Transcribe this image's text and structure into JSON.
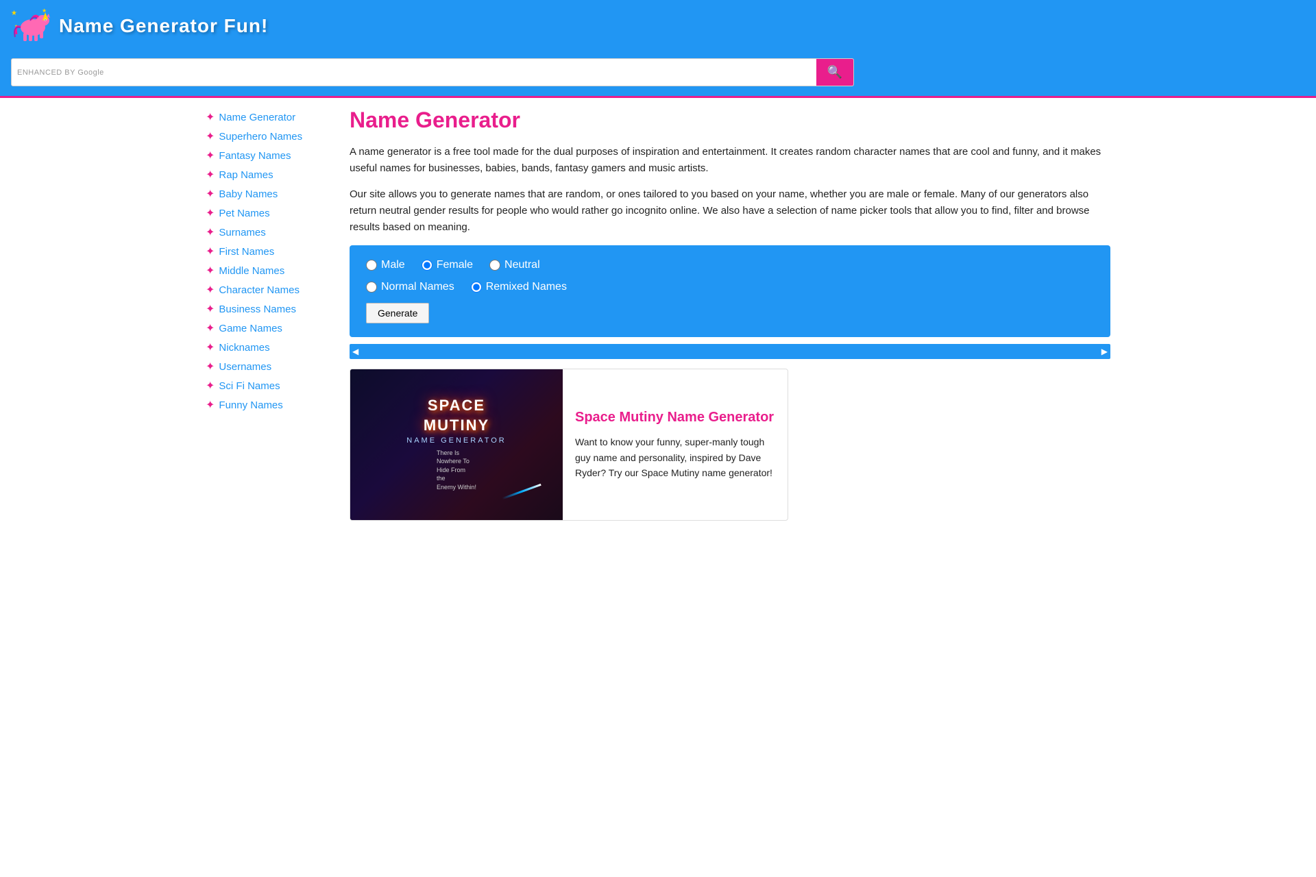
{
  "header": {
    "site_title": "Name Generator Fun!",
    "search_label": "ENHANCED BY Google",
    "search_placeholder": "",
    "search_button_icon": "🔍"
  },
  "sidebar": {
    "items": [
      {
        "label": "Name Generator",
        "id": "name-generator"
      },
      {
        "label": "Superhero Names",
        "id": "superhero-names"
      },
      {
        "label": "Fantasy Names",
        "id": "fantasy-names"
      },
      {
        "label": "Rap Names",
        "id": "rap-names"
      },
      {
        "label": "Baby Names",
        "id": "baby-names"
      },
      {
        "label": "Pet Names",
        "id": "pet-names"
      },
      {
        "label": "Surnames",
        "id": "surnames"
      },
      {
        "label": "First Names",
        "id": "first-names"
      },
      {
        "label": "Middle Names",
        "id": "middle-names"
      },
      {
        "label": "Character Names",
        "id": "character-names"
      },
      {
        "label": "Business Names",
        "id": "business-names"
      },
      {
        "label": "Game Names",
        "id": "game-names"
      },
      {
        "label": "Nicknames",
        "id": "nicknames"
      },
      {
        "label": "Usernames",
        "id": "usernames"
      },
      {
        "label": "Sci Fi Names",
        "id": "sci-fi-names"
      },
      {
        "label": "Funny Names",
        "id": "funny-names"
      }
    ]
  },
  "content": {
    "page_title": "Name Generator",
    "description_1": "A name generator is a free tool made for the dual purposes of inspiration and entertainment. It creates random character names that are cool and funny, and it makes useful names for businesses, babies, bands, fantasy gamers and music artists.",
    "description_2": "Our site allows you to generate names that are random, or ones tailored to you based on your name, whether you are male or female. Many of our generators also return neutral gender results for people who would rather go incognito online. We also have a selection of name picker tools that allow you to find, filter and browse results based on meaning.",
    "generator": {
      "gender_options": [
        "Male",
        "Female",
        "Neutral"
      ],
      "type_options": [
        "Normal Names",
        "Remixed Names"
      ],
      "selected_gender": "Female",
      "selected_type": "Remixed Names",
      "generate_label": "Generate"
    },
    "feature_card": {
      "title": "Space Mutiny Name Generator",
      "description": "Want to know your funny, super-manly tough guy name and personality, inspired by Dave Ryder? Try our Space Mutiny name generator!",
      "image_title_line1": "SPACE",
      "image_title_line2": "MUTINY",
      "image_subtitle": "NAME GENERATOR",
      "image_tagline_1": "There Is",
      "image_tagline_2": "Nowhere To",
      "image_tagline_3": "Hide From",
      "image_tagline_4": "the",
      "image_tagline_5": "Enemy Within!"
    }
  }
}
